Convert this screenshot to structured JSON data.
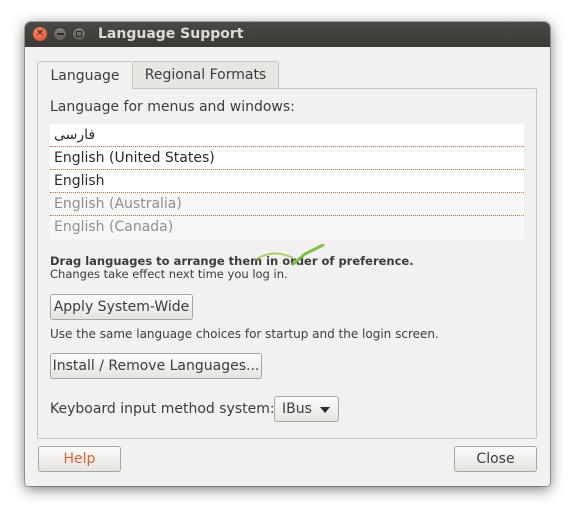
{
  "window": {
    "title": "Language Support"
  },
  "tabs": [
    {
      "label": "Language",
      "active": true
    },
    {
      "label": "Regional Formats",
      "active": false
    }
  ],
  "language": {
    "menus_label": "Language for menus and windows:",
    "languages": [
      {
        "label": "فارسی",
        "enabled": true
      },
      {
        "label": "English (United States)",
        "enabled": true
      },
      {
        "label": "English",
        "enabled": true
      },
      {
        "label": "English (Australia)",
        "enabled": false
      },
      {
        "label": "English (Canada)",
        "enabled": false
      }
    ],
    "drag_hint": "Drag languages to arrange them in order of preference.",
    "changes_hint": "Changes take effect next time you log in.",
    "apply_button": "Apply System-Wide",
    "apply_description": "Use the same language choices for startup and the login screen.",
    "install_button": "Install / Remove Languages...",
    "keyboard_label": "Keyboard input method system:",
    "keyboard_value": "IBus"
  },
  "footer": {
    "help_button": "Help",
    "close_button": "Close"
  },
  "colors": {
    "help_text": "#e0623a",
    "close_button": "#df4a1f",
    "list_divider": "#d46a4a"
  }
}
